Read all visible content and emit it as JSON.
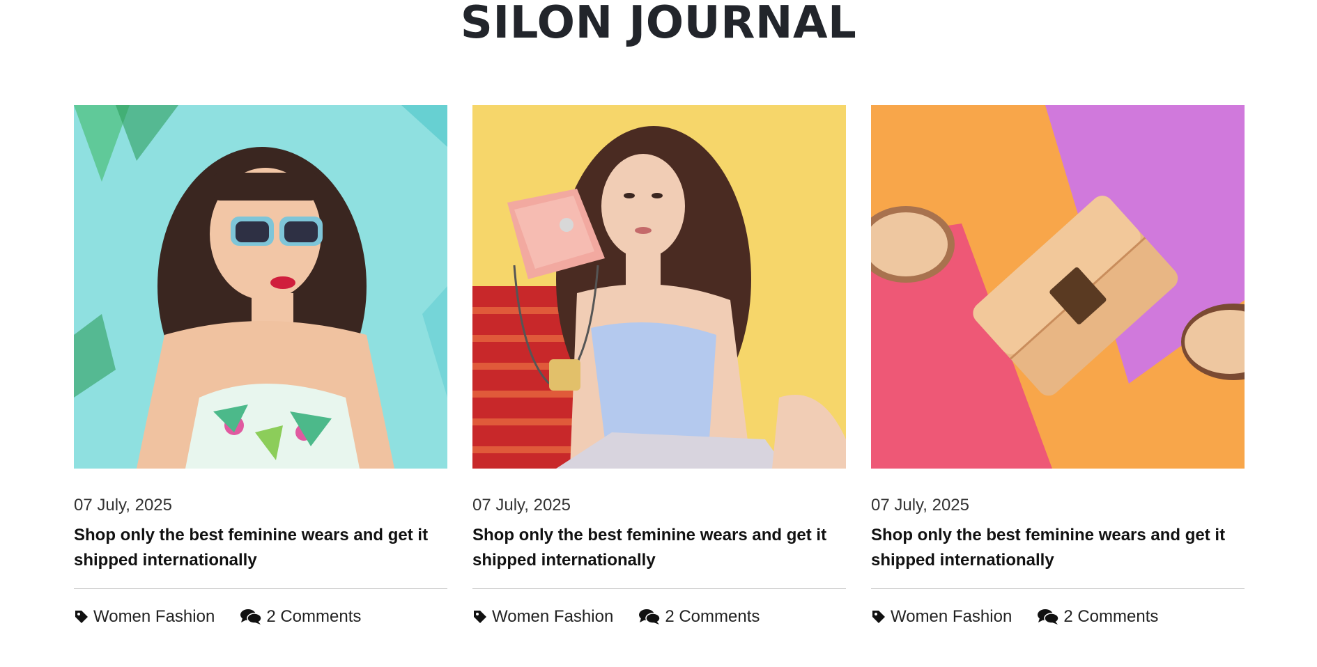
{
  "journal": {
    "title": "SILON JOURNAL"
  },
  "cards": [
    {
      "image": "woman-with-blue-sunglasses-on-teal-background",
      "date": "07 July, 2025",
      "title": "Shop only the best feminine wears and get it shipped internationally",
      "category": "Women Fashion",
      "comments": "2 Comments",
      "colors": {
        "background": "#8fe0e0",
        "accent": "#5cc9cf"
      }
    },
    {
      "image": "woman-with-pink-handbag-on-yellow-background",
      "date": "07 July, 2025",
      "title": "Shop only the best feminine wears and get it shipped internationally",
      "category": "Women Fashion",
      "comments": "2 Comments",
      "colors": {
        "background": "#f6d66a",
        "accent": "#d4322b"
      }
    },
    {
      "image": "tan-wallet-and-shoes-on-colorful-paper",
      "date": "07 July, 2025",
      "title": "Shop only the best feminine wears and get it shipped internationally",
      "category": "Women Fashion",
      "comments": "2 Comments",
      "colors": {
        "background": "#f8a64a",
        "accent": "#d079dc"
      }
    }
  ],
  "icons": {
    "category": "tag-icon",
    "comments": "comments-icon"
  }
}
